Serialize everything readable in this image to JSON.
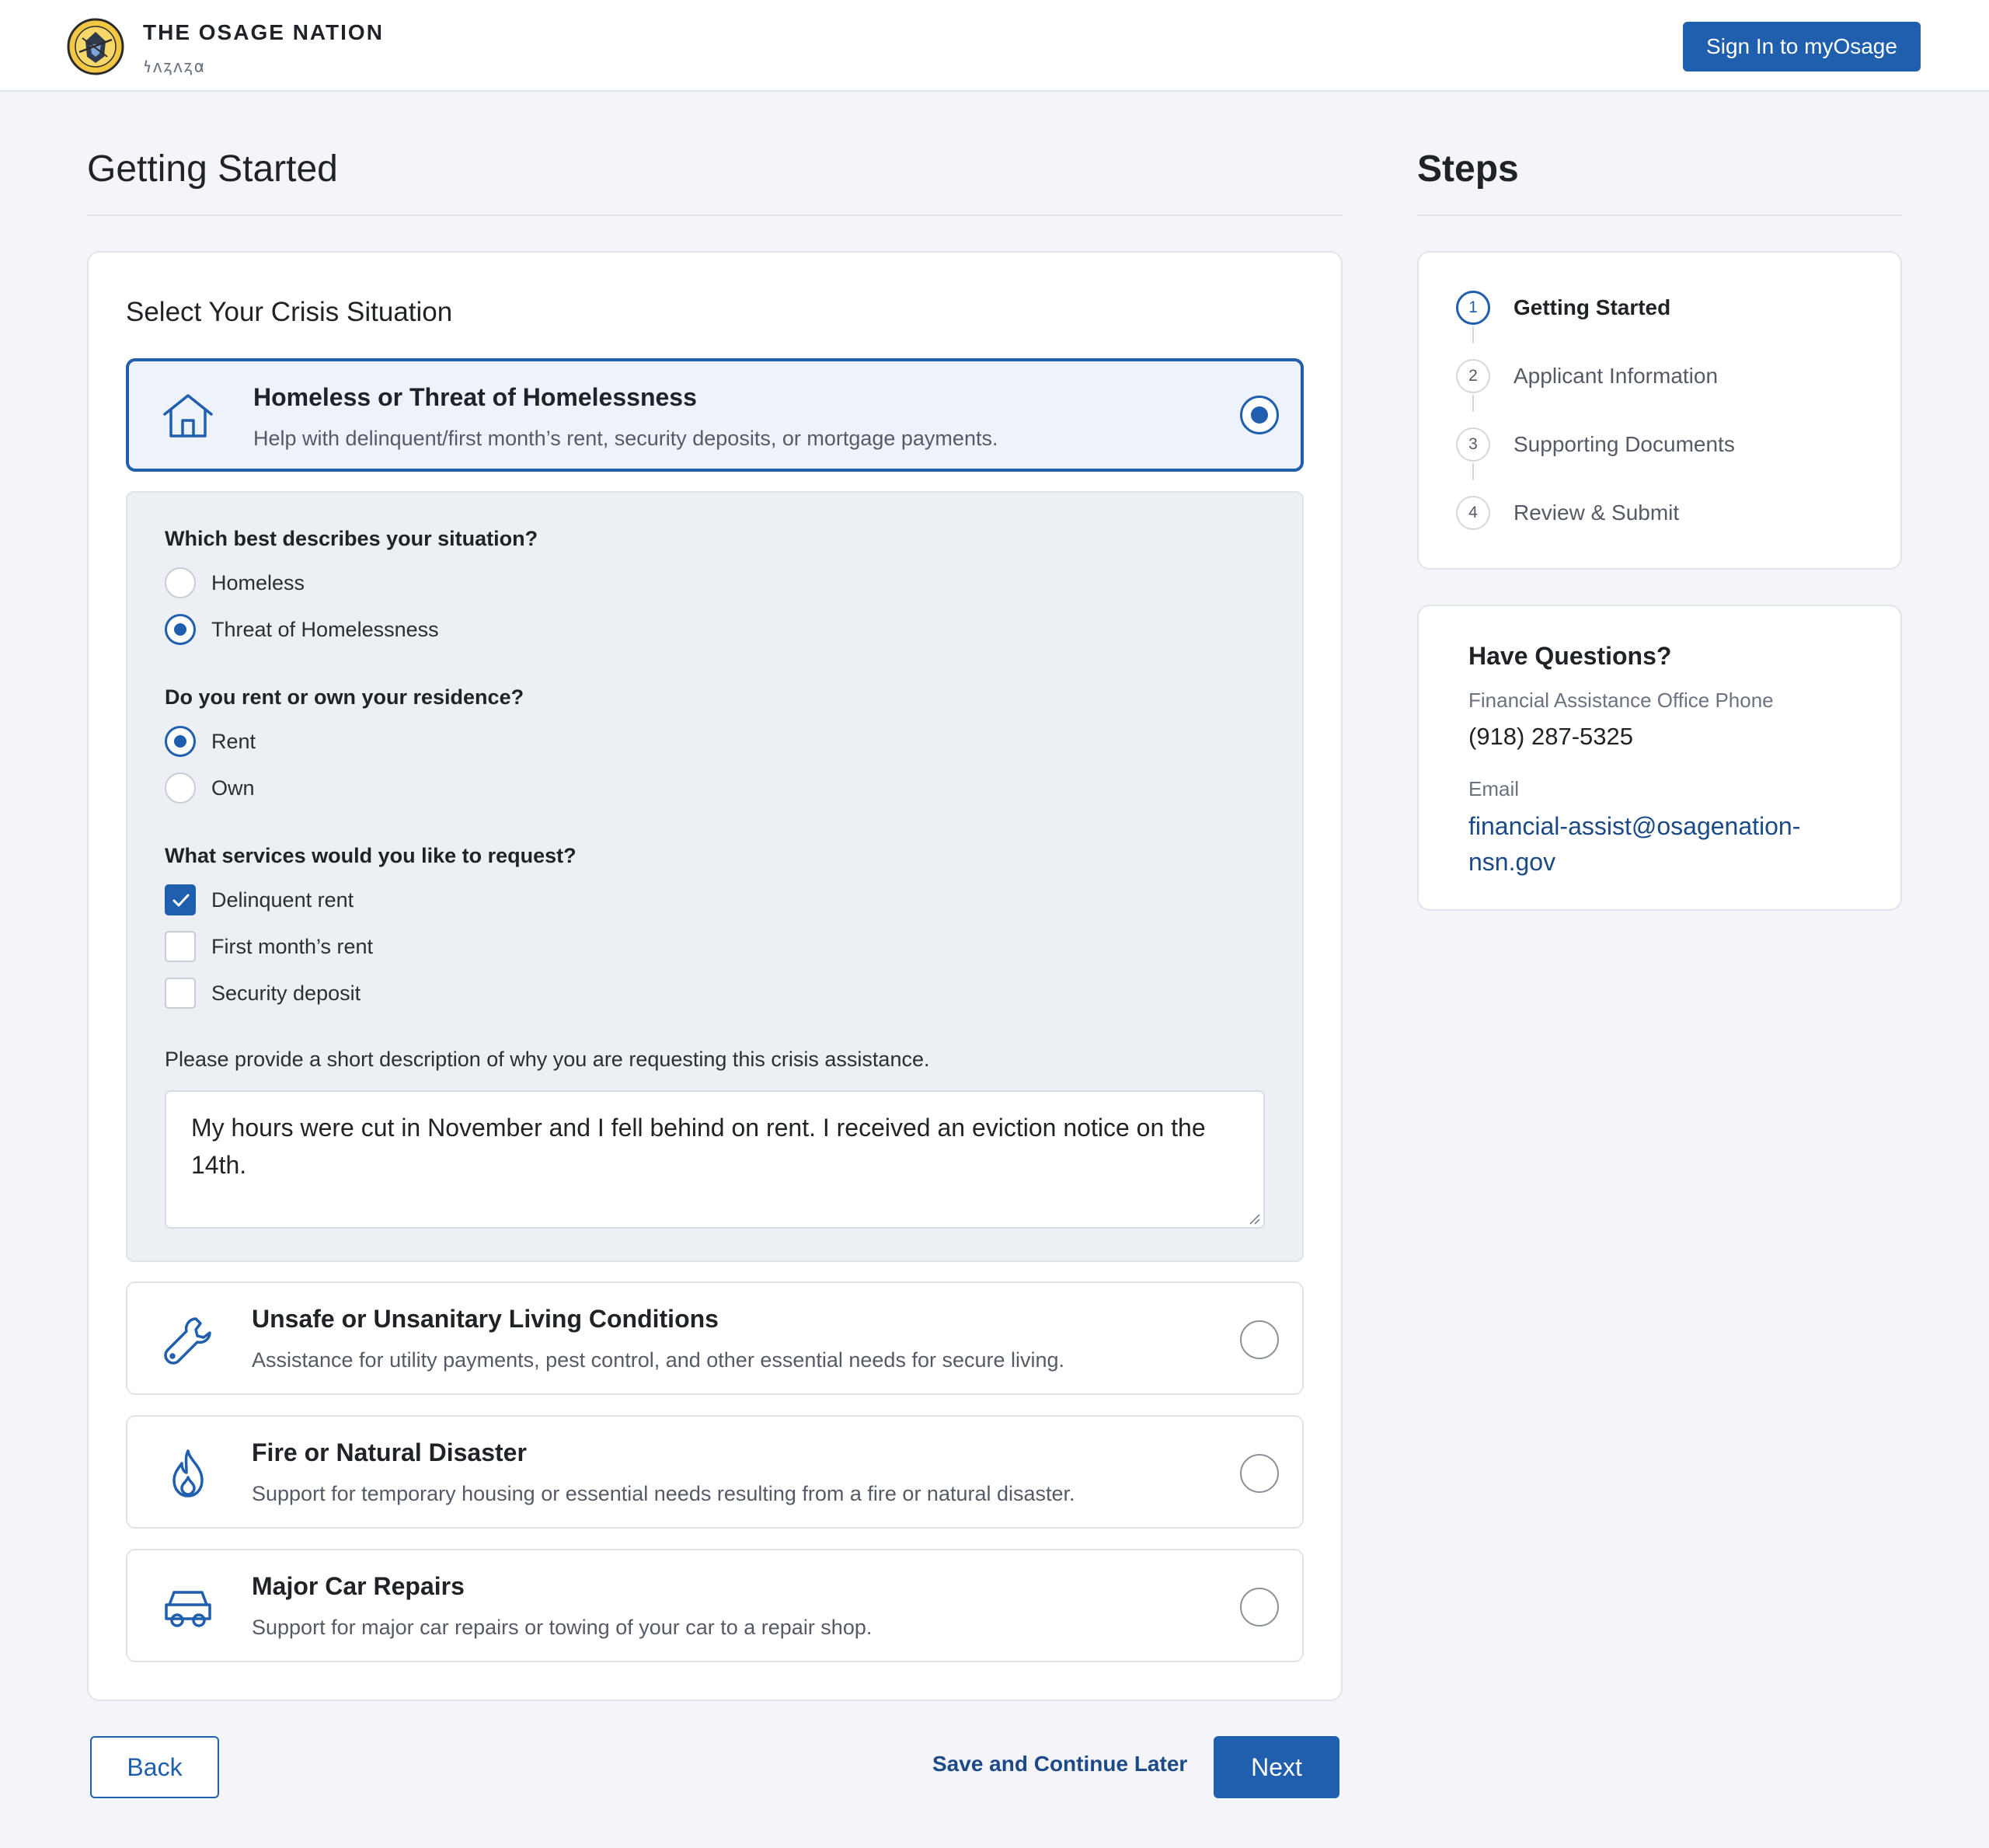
{
  "header": {
    "org_name": "THE OSAGE NATION",
    "org_subtitle": "𐓏𐓘𐓻𐓘𐓻𐓟",
    "signin_label": "Sign In to myOsage",
    "logo_icon": "osage-seal-icon"
  },
  "main": {
    "page_title": "Getting Started",
    "section_title": "Select Your Crisis Situation",
    "options": [
      {
        "title": "Homeless or Threat of Homelessness",
        "description": "Help with delinquent/first month’s rent, security deposits, or mortgage payments.",
        "icon": "house-icon",
        "selected": true
      },
      {
        "title": "Unsafe or Unsanitary Living Conditions",
        "description": "Assistance for utility payments, pest control, and other essential needs for secure living.",
        "icon": "wrench-icon",
        "selected": false
      },
      {
        "title": "Fire or Natural Disaster",
        "description": "Support for temporary housing or essential needs resulting from a fire or natural disaster.",
        "icon": "flame-icon",
        "selected": false
      },
      {
        "title": "Major Car Repairs",
        "description": "Support for major car repairs or towing of your car to a repair shop.",
        "icon": "car-icon",
        "selected": false
      }
    ],
    "subform": {
      "situation_question": "Which best describes your situation?",
      "situation_options": [
        "Homeless",
        "Threat of Homelessness"
      ],
      "situation_selected": "Threat of Homelessness",
      "residence_question": "Do you rent or own your residence?",
      "residence_options": [
        "Rent",
        "Own"
      ],
      "residence_selected": "Rent",
      "services_question": "What services would you like to request?",
      "services": [
        {
          "label": "Delinquent rent",
          "checked": true
        },
        {
          "label": "First month’s rent",
          "checked": false
        },
        {
          "label": "Security deposit",
          "checked": false
        }
      ],
      "description_prompt": "Please provide a short description of why you are requesting this crisis assistance.",
      "description_value": "My hours were cut in November and I fell behind on rent. I received an eviction notice on the 14th."
    },
    "footer": {
      "back_label": "Back",
      "save_later_label": "Save and Continue Later",
      "next_label": "Next"
    }
  },
  "sidebar": {
    "steps_title": "Steps",
    "steps": [
      {
        "number": "1",
        "label": "Getting Started",
        "active": true
      },
      {
        "number": "2",
        "label": "Applicant Information",
        "active": false
      },
      {
        "number": "3",
        "label": "Supporting Documents",
        "active": false
      },
      {
        "number": "4",
        "label": "Review & Submit",
        "active": false
      }
    ],
    "questions": {
      "title": "Have Questions?",
      "phone_label": "Financial Assistance Office Phone",
      "phone": "(918) 287-5325",
      "email_label": "Email",
      "email": "financial-assist@osagenation-nsn.gov"
    }
  },
  "colors": {
    "accent": "#1f5fad",
    "page_bg": "#f4f5f9",
    "selected_card_bg": "#eef3fb",
    "subpanel_bg": "#eceff4",
    "link": "#1b4a86"
  }
}
